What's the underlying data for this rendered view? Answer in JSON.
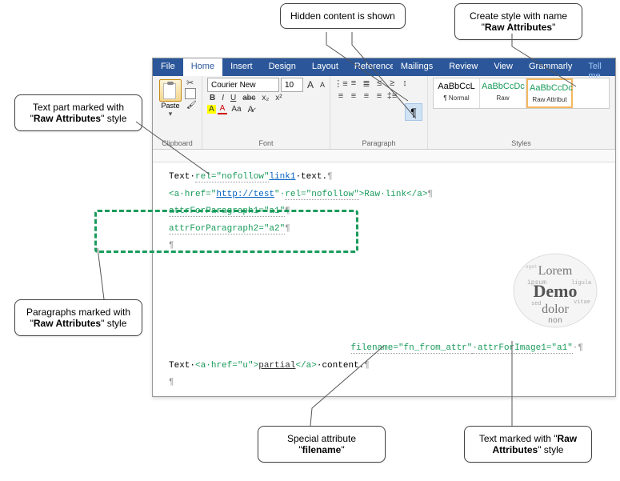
{
  "tabs": {
    "file": "File",
    "home": "Home",
    "insert": "Insert",
    "design": "Design",
    "layout": "Layout",
    "references": "References",
    "mailings": "Mailings",
    "review": "Review",
    "view": "View",
    "grammarly": "Grammarly",
    "tellme": "Tell me"
  },
  "clipboard": {
    "paste": "Paste",
    "label": "Clipboard"
  },
  "font": {
    "name": "Courier New",
    "size": "10",
    "label": "Font",
    "bold": "B",
    "italic": "I",
    "underline": "U",
    "strike": "abc",
    "sub": "x₂",
    "sup": "x²",
    "case": "Aa",
    "grow": "A",
    "shrink": "A",
    "highlight": "A",
    "color": "A"
  },
  "paragraph": {
    "label": "Paragraph",
    "pilcrow": "¶"
  },
  "styles": {
    "label": "Styles",
    "items": [
      {
        "preview": "AaBbCcL",
        "name": "¶ Normal",
        "color": "#333"
      },
      {
        "preview": "AaBbCcDc",
        "name": "Raw",
        "color": "#1a9b5b"
      },
      {
        "preview": "AaBbCcDc",
        "name": "Raw Attribut",
        "color": "#1a9b5b"
      }
    ]
  },
  "document": {
    "line1_pre": "Text·",
    "line1_attr": "rel=\"nofollow\"",
    "line1_link": "link1",
    "line1_post": "·text.",
    "line2_pre": "<a·href=\"",
    "line2_url": "http://test",
    "line2_mid": "\"·",
    "line2_attr": "rel=\"nofollow\"",
    "line2_post": ">Raw·link</a>",
    "line3": "attrForParagraph1=\"a1\"",
    "line4": "attrForParagraph2=\"a2\"",
    "line5_a": "filename=\"fn_from_attr\"",
    "line5_b": "·attrForImage1=\"a1\"",
    "line6_pre": "Text·",
    "line6_raw1": "<a·href=\"u\">",
    "line6_mid": "partial",
    "line6_raw2": "</a>",
    "line6_post": "·content.",
    "pil": "¶"
  },
  "callouts": {
    "hidden": "Hidden content is shown",
    "create_pre": "Create style with name \"",
    "create_b": "Raw Attributes",
    "create_post": "\"",
    "marked_pre": "Text part marked with \"",
    "marked_b": "Raw Attributes",
    "marked_post": "\" style",
    "paras_pre": "Paragraphs marked with \"",
    "paras_b": "Raw Attributes",
    "paras_post": "\" style",
    "special_pre": "Special attribute \"",
    "special_b": "filename",
    "special_post": "\"",
    "textmark_pre": "Text marked with \"",
    "textmark_b": "Raw Attributes",
    "textmark_post": "\" style"
  }
}
